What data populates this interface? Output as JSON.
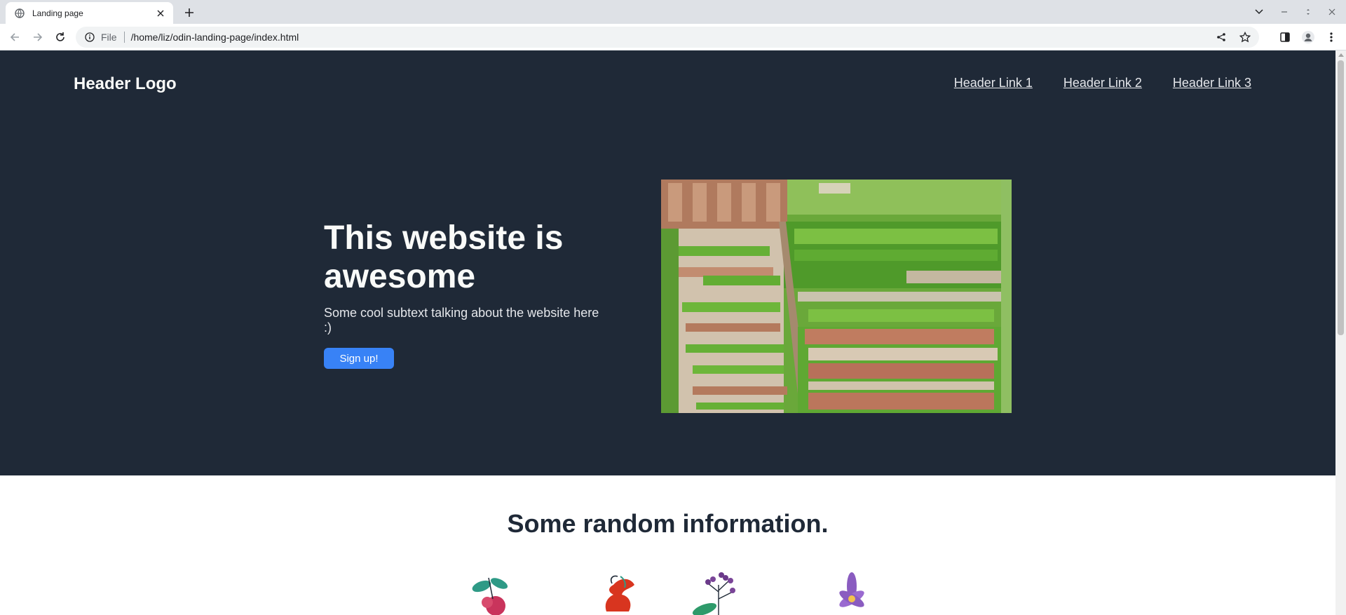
{
  "browser": {
    "tab_title": "Landing page",
    "omnibox_chip": "File",
    "url": "/home/liz/odin-landing-page/index.html"
  },
  "page": {
    "header": {
      "logo": "Header Logo",
      "links": [
        "Header Link 1",
        "Header Link 2",
        "Header Link 3"
      ]
    },
    "hero": {
      "title": "This website is awesome",
      "subtext": "Some cool subtext talking about the website here :)",
      "button_label": "Sign up!"
    },
    "info": {
      "title": "Some random information."
    }
  },
  "colors": {
    "hero_bg": "#1f2937",
    "hero_heading": "#f9faf8",
    "hero_text": "#e5e7eb",
    "button_bg": "#3882f6"
  },
  "icons": [
    "globe-favicon-icon",
    "close-icon",
    "plus-icon",
    "back-arrow-icon",
    "forward-arrow-icon",
    "reload-icon",
    "info-icon",
    "share-icon",
    "star-icon",
    "side-panel-icon",
    "profile-icon",
    "kebab-menu-icon",
    "chevron-down-icon",
    "minimize-icon",
    "maximize-icon"
  ]
}
